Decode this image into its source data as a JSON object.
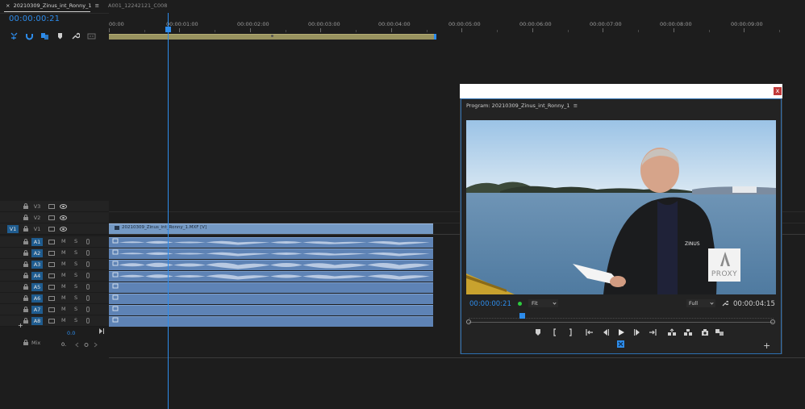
{
  "tabs": {
    "active": {
      "label": "20210309_Zinus_int_Ronny_1",
      "menu": "≡",
      "close": "×"
    },
    "second": {
      "label": "A001_12242121_C008"
    }
  },
  "timeline": {
    "timecode": "00:00:00:21",
    "ruler_labels": [
      "00:00",
      "00:00:01:00",
      "00:00:02:00",
      "00:00:03:00",
      "00:00:04:00",
      "00:00:05:00",
      "00:00:06:00",
      "00:00:07:00",
      "00:00:08:00",
      "00:00:09:00"
    ],
    "video_tracks": [
      "V3",
      "V2",
      "V1"
    ],
    "source_patch": "V1",
    "audio_tracks": [
      "A1",
      "A2",
      "A3",
      "A4",
      "A5",
      "A6",
      "A7",
      "A8"
    ],
    "mute_label": "M",
    "solo_label": "S",
    "volume_value": "0.0",
    "mix": {
      "label": "Mix",
      "value": "0."
    },
    "video_clip_name": "20210309_Zinus_int_Ronny_1.MXF [V]",
    "plus_icon": "+"
  },
  "program_monitor": {
    "window_close": "x",
    "title": "Program: 20210309_Zinus_int_Ronny_1",
    "title_menu": "≡",
    "timecode": "00:00:00:21",
    "zoom": "Fit",
    "resolution": "Full",
    "duration": "00:00:04:15",
    "proxy_label": "PROXY",
    "jacket_logo": "ZINUS",
    "add_button": "+"
  },
  "colors": {
    "accent": "#2d8ceb",
    "video_clip": "#7499c4",
    "audio_clip": "#5e83b5",
    "work_area": "#98925f",
    "close_button": "#c13a3a"
  }
}
